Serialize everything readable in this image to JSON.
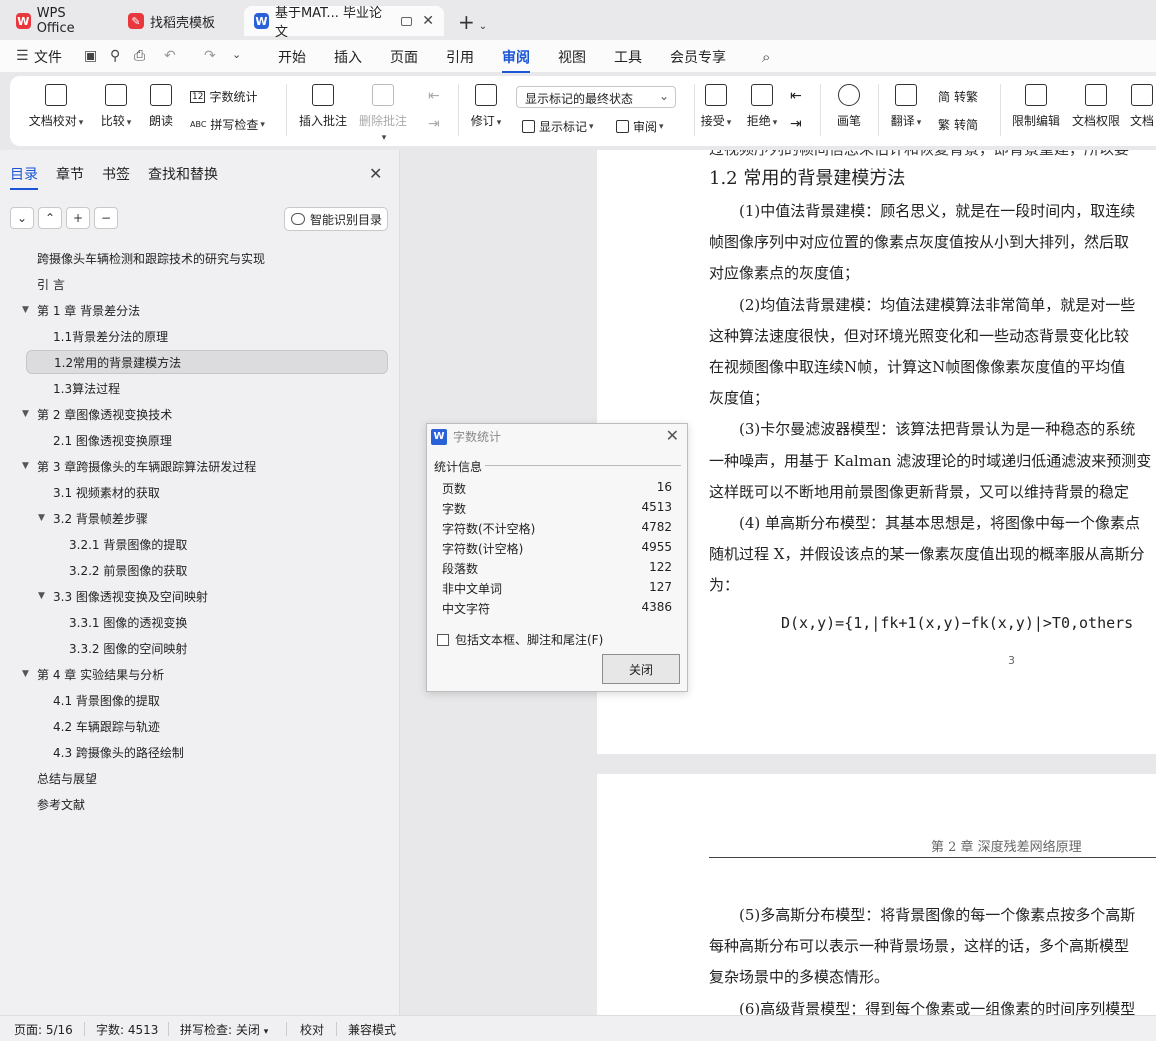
{
  "tabs": [
    {
      "label": "WPS Office",
      "icon": "wps-logo-icon"
    },
    {
      "label": "找稻壳模板",
      "icon": "docer-icon"
    },
    {
      "label": "基于MAT... 毕业论文",
      "icon": "writer-doc-icon"
    }
  ],
  "menu": {
    "file": "文件",
    "items": [
      "开始",
      "插入",
      "页面",
      "引用",
      "审阅",
      "视图",
      "工具",
      "会员专享"
    ],
    "active": "审阅"
  },
  "ribbon": {
    "doc_check": "文档校对",
    "compare": "比较",
    "read_aloud": "朗读",
    "word_count": "字数统计",
    "spell_check": "拼写检查",
    "insert_comment": "插入批注",
    "delete_comment": "删除批注",
    "revise": "修订",
    "markup_state": "显示标记的最终状态",
    "show_markup": "显示标记",
    "review": "审阅",
    "accept": "接受",
    "reject": "拒绝",
    "pen": "画笔",
    "translate": "翻译",
    "to_traditional": "转繁",
    "to_simplified": "转简",
    "restrict_edit": "限制编辑",
    "doc_permission": "文档权限",
    "doc_more": "文档",
    "abc_prefix": "ABC",
    "num_prefix": "12",
    "trad_char": "繁"
  },
  "panel": {
    "tabs": [
      "目录",
      "章节",
      "书签",
      "查找和替换"
    ],
    "smart_toc": "智能识别目录",
    "toc": [
      {
        "label": "跨摄像头车辆检测和跟踪技术的研究与实现",
        "level": 0,
        "arrow": false
      },
      {
        "label": "引 言",
        "level": 0,
        "arrow": false
      },
      {
        "label": "第 1 章  背景差分法",
        "level": 0,
        "arrow": true
      },
      {
        "label": "1.1背景差分法的原理",
        "level": 1,
        "arrow": false
      },
      {
        "label": "1.2常用的背景建模方法",
        "level": 1,
        "arrow": false,
        "selected": true
      },
      {
        "label": "1.3算法过程",
        "level": 1,
        "arrow": false
      },
      {
        "label": "第 2 章图像透视变换技术",
        "level": 0,
        "arrow": true
      },
      {
        "label": "2.1 图像透视变换原理",
        "level": 1,
        "arrow": false
      },
      {
        "label": "第 3 章跨摄像头的车辆跟踪算法研发过程",
        "level": 0,
        "arrow": true
      },
      {
        "label": "3.1 视频素材的获取",
        "level": 1,
        "arrow": false
      },
      {
        "label": "3.2  背景帧差步骤",
        "level": 1,
        "arrow": true
      },
      {
        "label": "3.2.1 背景图像的提取",
        "level": 2,
        "arrow": false
      },
      {
        "label": "3.2.2 前景图像的获取",
        "level": 2,
        "arrow": false
      },
      {
        "label": "3.3  图像透视变换及空间映射",
        "level": 1,
        "arrow": true
      },
      {
        "label": "3.3.1 图像的透视变换",
        "level": 2,
        "arrow": false
      },
      {
        "label": "3.3.2 图像的空间映射",
        "level": 2,
        "arrow": false
      },
      {
        "label": "第 4 章  实验结果与分析",
        "level": 0,
        "arrow": true
      },
      {
        "label": "4.1  背景图像的提取",
        "level": 1,
        "arrow": false
      },
      {
        "label": "4.2  车辆跟踪与轨迹",
        "level": 1,
        "arrow": false
      },
      {
        "label": "4.3  跨摄像头的路径绘制",
        "level": 1,
        "arrow": false
      },
      {
        "label": "总结与展望",
        "level": 0,
        "arrow": false
      },
      {
        "label": "参考文献",
        "level": 0,
        "arrow": false
      }
    ]
  },
  "document": {
    "cut_line": "过视频序列的帧间信息来估计和恢复背景，即背景重建，所以要",
    "heading": "1.2 常用的背景建模方法",
    "lines": [
      "(1)中值法背景建模：顾名思义，就是在一段时间内，取连续",
      "帧图像序列中对应位置的像素点灰度值按从小到大排列，然后取",
      "对应像素点的灰度值；",
      "(2)均值法背景建模：均值法建模算法非常简单，就是对一些",
      "这种算法速度很快，但对环境光照变化和一些动态背景变化比较",
      "在视频图像中取连续N帧，计算这N帧图像像素灰度值的平均值",
      "灰度值；",
      "(3)卡尔曼滤波器模型：该算法把背景认为是一种稳态的系统",
      "一种噪声，用基于 Kalman 滤波理论的时域递归低通滤波来预测变",
      "这样既可以不断地用前景图像更新背景，又可以维持背景的稳定",
      "(4) 单高斯分布模型：其基本思想是，将图像中每一个像素点",
      "随机过程 X，并假设该点的某一像素灰度值出现的概率服从高斯分",
      "为："
    ],
    "formula": "D(x,y)={1,|fk+1(x,y)−fk(x,y)|>T0,others",
    "page_number": "3",
    "page2_header": "第 2 章  深度残差网络原理",
    "page2_lines": [
      "(5)多高斯分布模型：将背景图像的每一个像素点按多个高斯",
      "每种高斯分布可以表示一种背景场景，这样的话，多个高斯模型",
      "复杂场景中的多模态情形。",
      "(6)高级背景模型：得到每个像素或一组像素的时间序列模型"
    ]
  },
  "dialog": {
    "title": "字数统计",
    "section": "统计信息",
    "stats": [
      {
        "label": "页数",
        "value": "16"
      },
      {
        "label": "字数",
        "value": "4513"
      },
      {
        "label": "字符数(不计空格)",
        "value": "4782"
      },
      {
        "label": "字符数(计空格)",
        "value": "4955"
      },
      {
        "label": "段落数",
        "value": "122"
      },
      {
        "label": "非中文单词",
        "value": "127"
      },
      {
        "label": "中文字符",
        "value": "4386"
      }
    ],
    "checkbox_label": "包括文本框、脚注和尾注(F)",
    "close_button": "关闭"
  },
  "status": {
    "page": "页面: 5/16",
    "words": "字数: 4513",
    "spell": "拼写检查: 关闭",
    "proof": "校对",
    "compat": "兼容模式"
  },
  "colors": {
    "accent": "#1a56d6",
    "wps_red": "#e8383d",
    "writer_blue": "#2a60d8"
  }
}
